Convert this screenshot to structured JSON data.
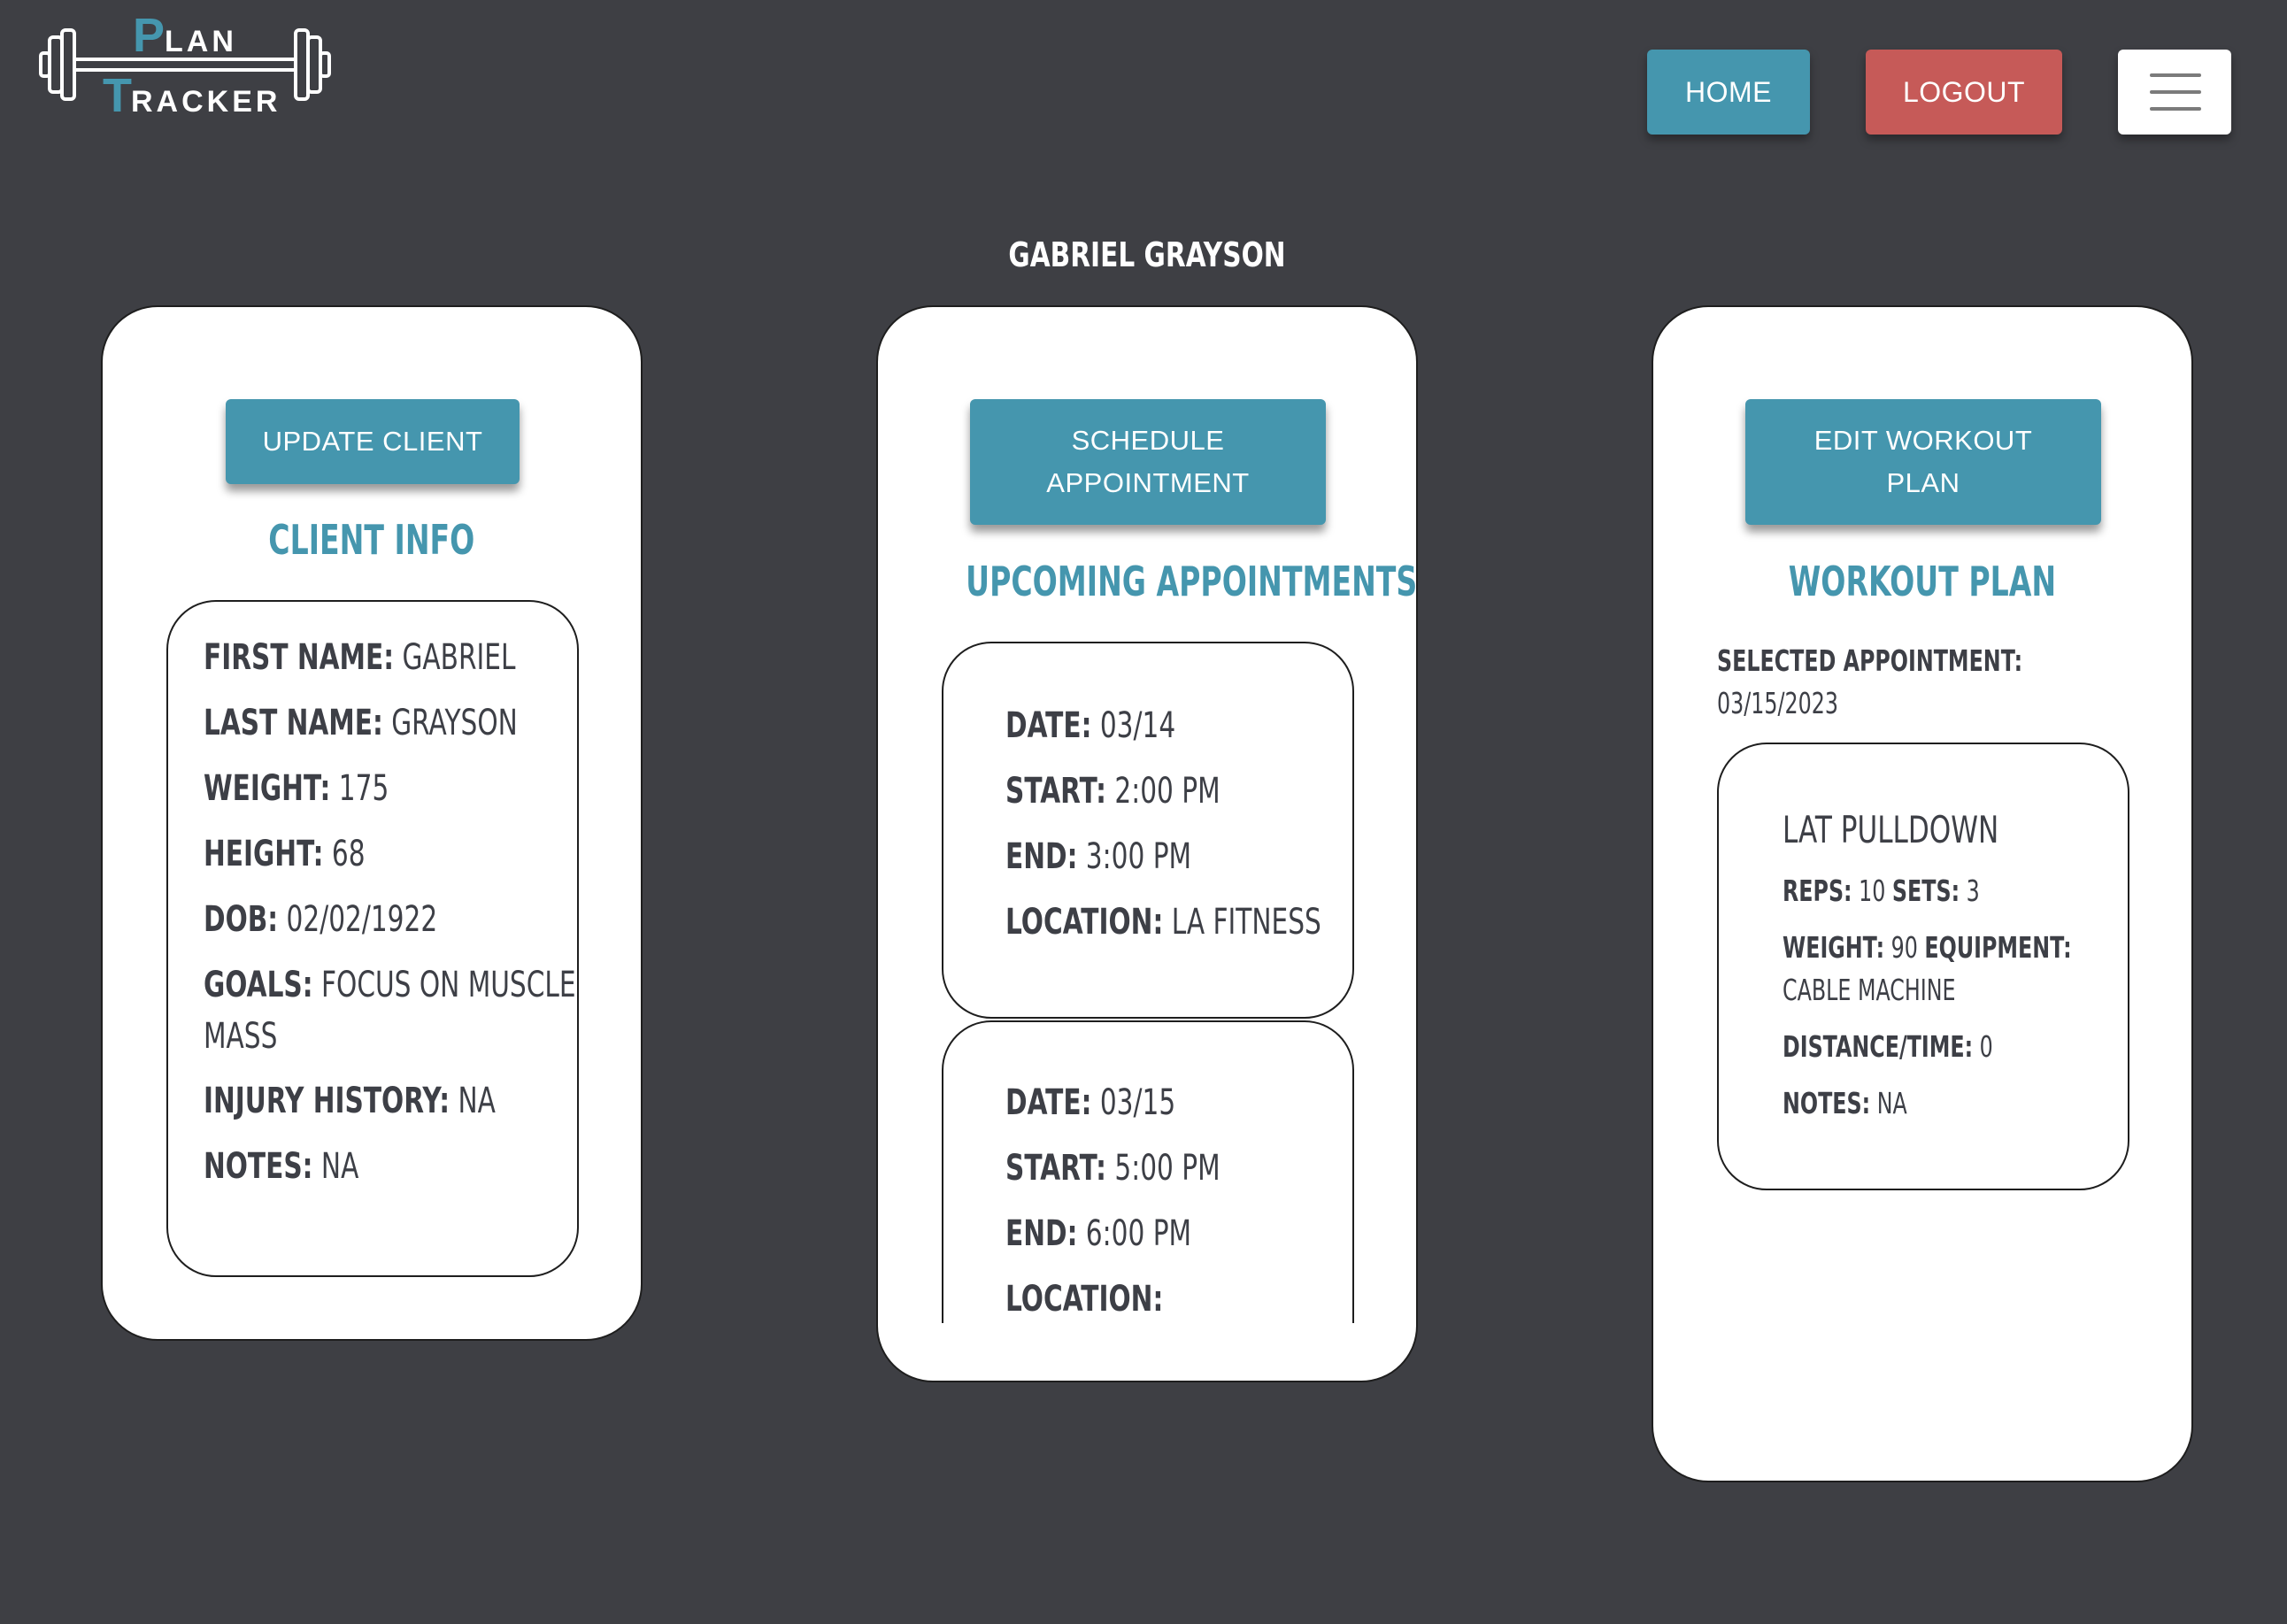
{
  "header": {
    "logo": {
      "line1_initial": "P",
      "line1_rest": "LAN",
      "line2_initial": "T",
      "line2_rest": "RACKER"
    },
    "home_label": "HOME",
    "logout_label": "LOGOUT",
    "menu_icon": "hamburger-icon"
  },
  "page_title": "GABRIEL GRAYSON",
  "client_card": {
    "button_label": "UPDATE CLIENT",
    "heading": "CLIENT INFO",
    "fields": {
      "first_name": {
        "label": "FIRST NAME:",
        "value": "GABRIEL"
      },
      "last_name": {
        "label": "LAST NAME:",
        "value": "GRAYSON"
      },
      "weight": {
        "label": "WEIGHT:",
        "value": "175"
      },
      "height": {
        "label": "HEIGHT:",
        "value": "68"
      },
      "dob": {
        "label": "DOB:",
        "value": "02/02/1922"
      },
      "goals": {
        "label": "GOALS:",
        "value_line1": "FOCUS ON MUSCLE",
        "value_line2": "MASS"
      },
      "injury_history": {
        "label": "INJURY HISTORY:",
        "value": "NA"
      },
      "notes": {
        "label": "NOTES:",
        "value": "NA"
      }
    }
  },
  "appointments_card": {
    "button_label_line1": "SCHEDULE",
    "button_label_line2": "APPOINTMENT",
    "heading": "UPCOMING APPOINTMENTS",
    "appointments": [
      {
        "date_label": "DATE:",
        "date": "03/14",
        "start_label": "START:",
        "start": "2:00 PM",
        "end_label": "END:",
        "end": "3:00 PM",
        "location_label": "LOCATION:",
        "location": "LA FITNESS"
      },
      {
        "date_label": "DATE:",
        "date": "03/15",
        "start_label": "START:",
        "start": "5:00 PM",
        "end_label": "END:",
        "end": "6:00 PM",
        "location_label": "LOCATION:",
        "location": ""
      }
    ]
  },
  "workout_card": {
    "button_label_line1": "EDIT WORKOUT",
    "button_label_line2": "PLAN",
    "heading": "WORKOUT PLAN",
    "selected_label": "SELECTED APPOINTMENT:",
    "selected_date": "03/15/2023",
    "exercise": {
      "name": "LAT PULLDOWN",
      "reps_label": "REPS:",
      "reps": "10",
      "sets_label": "SETS:",
      "sets": "3",
      "weight_label": "WEIGHT:",
      "weight": "90",
      "equipment_label": "EQUIPMENT:",
      "equipment": "CABLE MACHINE",
      "distance_label": "DISTANCE/TIME:",
      "distance": "0",
      "notes_label": "NOTES:",
      "notes": "NA"
    }
  },
  "colors": {
    "background": "#3e3f44",
    "accent": "#4596ae",
    "logout": "#c65a58",
    "text": "#3d3f46"
  }
}
